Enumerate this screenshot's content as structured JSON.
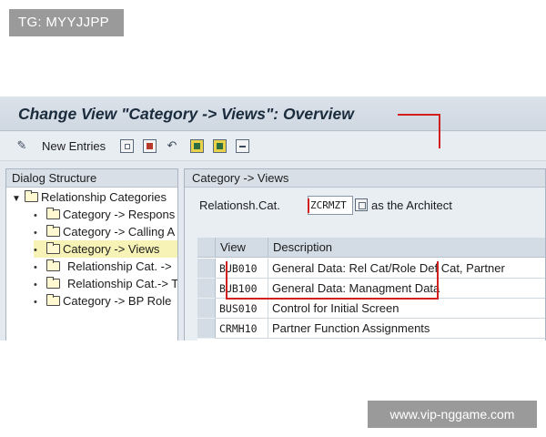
{
  "watermarks": {
    "top": "TG: MYYJJPP",
    "bottom": "www.vip-nggame.com"
  },
  "window": {
    "title": "Change View \"Category -> Views\": Overview"
  },
  "toolbar": {
    "new_entries_label": "New Entries"
  },
  "tree": {
    "header": "Dialog Structure",
    "root": "Relationship Categories",
    "items": [
      {
        "label": "Category -> Respons"
      },
      {
        "label": "Category -> Calling A"
      },
      {
        "label": "Category -> Views"
      },
      {
        "label": "Relationship Cat. ->"
      },
      {
        "label": "Relationship Cat.-> T"
      },
      {
        "label": "Category -> BP Role"
      }
    ]
  },
  "main": {
    "header": "Category -> Views",
    "relcat_label": "Relationsh.Cat.",
    "relcat_value": "ZCRMZT",
    "relcat_desc": "as the Architect",
    "table": {
      "columns": [
        "View",
        "Description"
      ],
      "rows": [
        {
          "view": "BUB010",
          "description": "General Data: Rel Cat/Role Def Cat, Partner"
        },
        {
          "view": "BUB100",
          "description": "General Data: Managment Data"
        },
        {
          "view": "BUS010",
          "description": "Control for Initial Screen"
        },
        {
          "view": "CRMH10",
          "description": "Partner Function Assignments"
        }
      ]
    }
  },
  "colors": {
    "annotation": "#d21f1f",
    "selected_row": "#f7f3b6",
    "panel_bg": "#e4e9ef"
  }
}
